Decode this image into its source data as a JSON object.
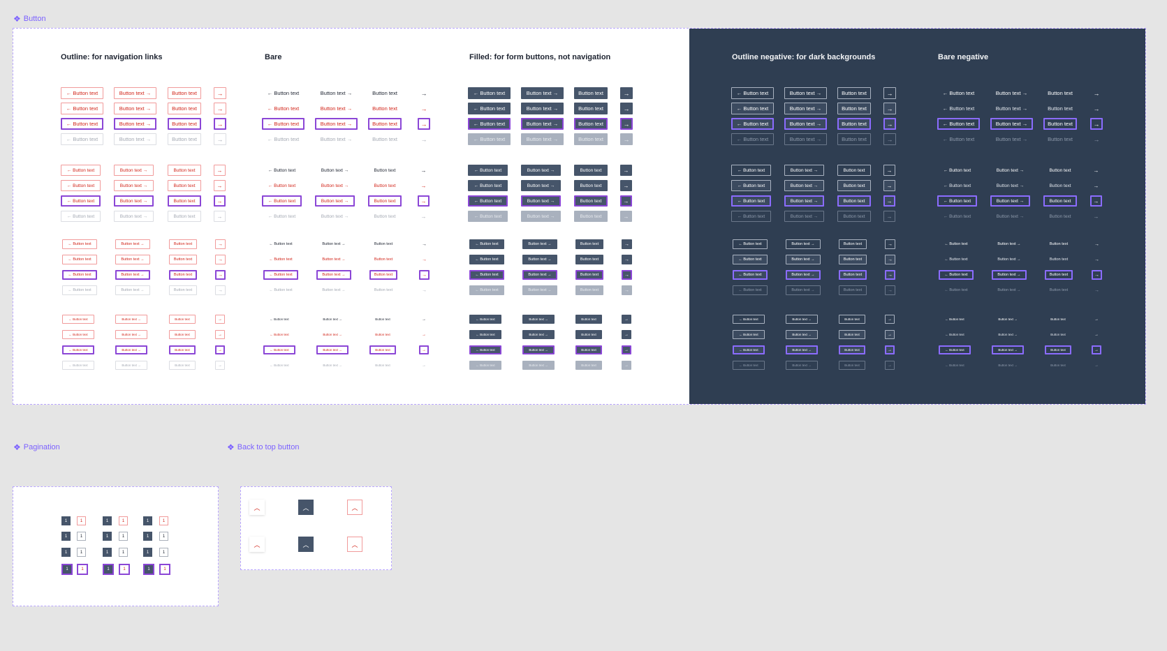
{
  "frames": {
    "button": "Button",
    "pagination": "Pagination",
    "back_to_top": "Back to top button"
  },
  "sections": {
    "outline": "Outline: for navigation links",
    "bare": "Bare",
    "filled": "Filled: for form buttons, not navigation",
    "outline_negative": "Outline negative: for dark backgrounds",
    "bare_negative": "Bare negative"
  },
  "button_label": "Button text",
  "glyphs": {
    "arrow_left": "←",
    "arrow_right": "→",
    "chevron_up": "︿"
  },
  "sizes": [
    "large",
    "medium",
    "small",
    "xsmall"
  ],
  "states": [
    "default",
    "hover",
    "focus",
    "disabled"
  ],
  "pagination_label": "1",
  "colors": {
    "accent": "#7b61ff",
    "focus": "#8b46d6",
    "brand_red": "#d2261b",
    "filled": "#46556a",
    "dark_panel": "#2f3e52"
  }
}
